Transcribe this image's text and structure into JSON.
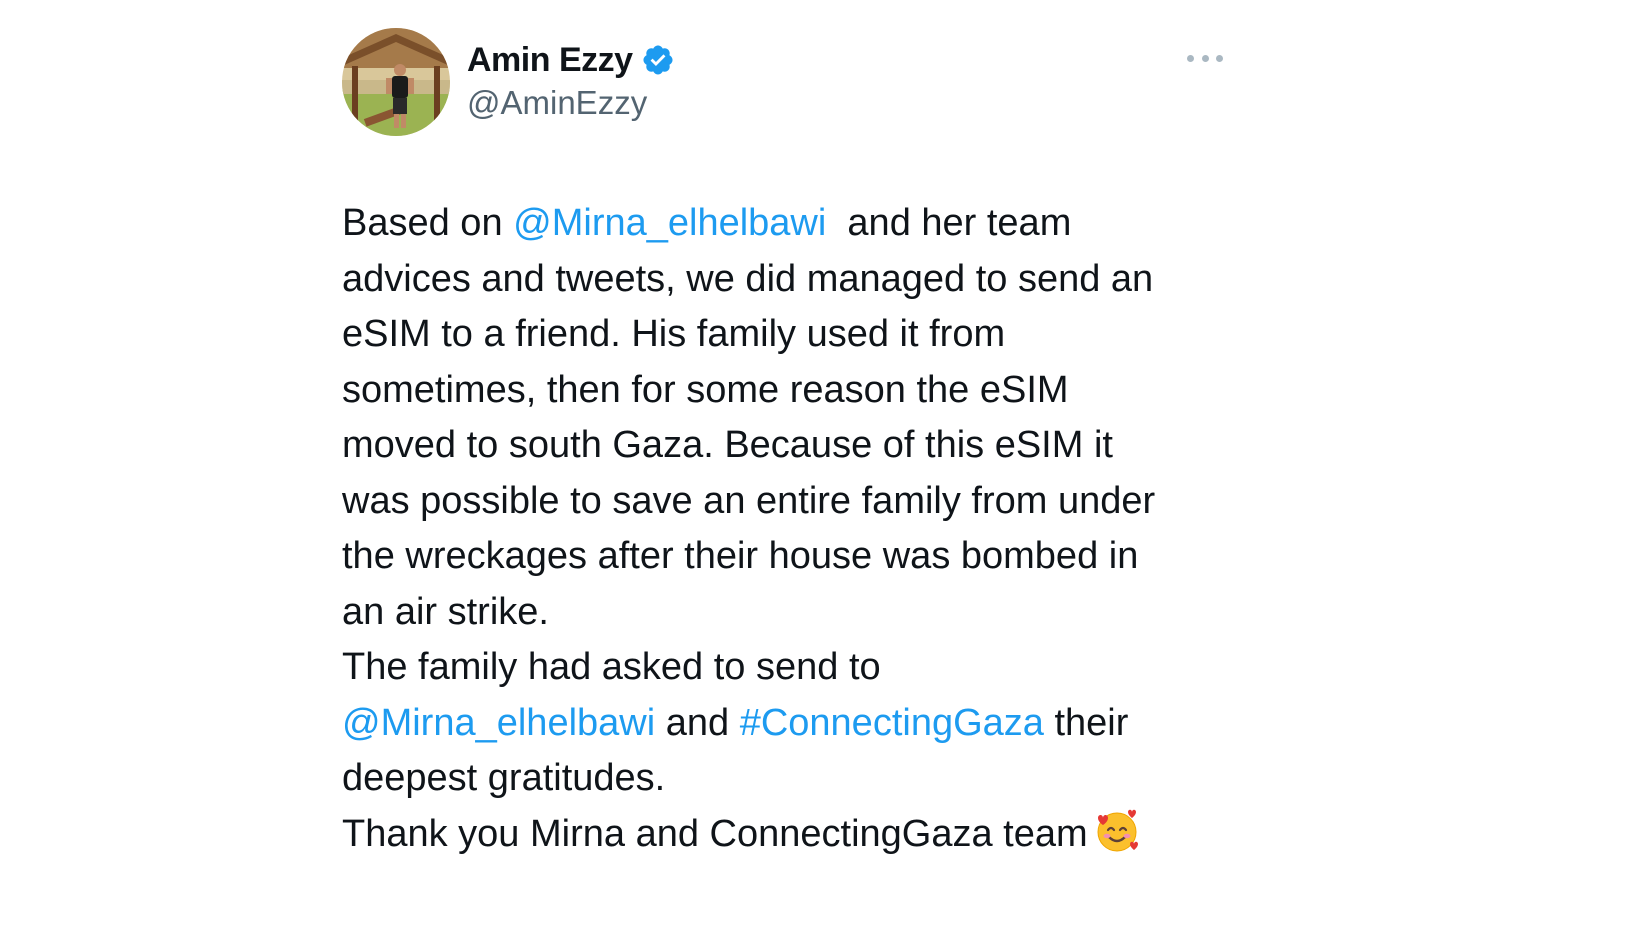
{
  "author": {
    "display_name": "Amin Ezzy",
    "handle": "@AminEzzy",
    "verified_icon": "verified-badge-icon",
    "avatar_icon": "profile-photo"
  },
  "menu": {
    "more_icon": "more-horizontal-icon"
  },
  "colors": {
    "link": "#1d9bf0",
    "text": "#0f1419",
    "secondary": "#536471"
  },
  "tweet": {
    "l1_a": "Based on ",
    "mention_1": "@Mirna_elhelbawi",
    "l1_b": "  and her team",
    "l2": "advices and tweets, we did managed to send an",
    "l3": "eSIM to a friend. His family used it from",
    "l4": "sometimes, then for some reason the eSIM",
    "l5": "moved to south Gaza. Because of this eSIM it",
    "l6": "was possible to save an entire family from under",
    "l7": "the wreckages after their house was bombed in",
    "l8": "an air strike.",
    "l9": "The family had asked to send to",
    "mention_2": "@Mirna_elhelbawi",
    "l10_a": " and ",
    "hashtag": "#ConnectingGaza",
    "l10_b": " their",
    "l11": "deepest gratitudes.",
    "l12": "Thank you Mirna and ConnectingGaza team",
    "emoji_icon": "smiling-face-with-hearts-icon"
  }
}
